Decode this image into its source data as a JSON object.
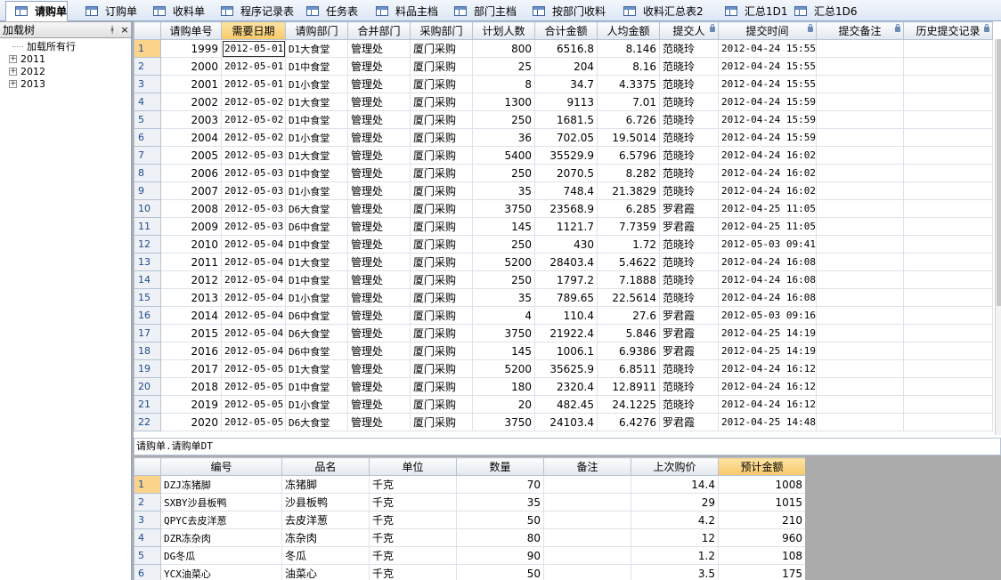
{
  "tabs": [
    {
      "label": "请购单",
      "active": true
    },
    {
      "label": "订购单"
    },
    {
      "label": "收料单"
    },
    {
      "label": "程序记录表"
    },
    {
      "label": "任务表"
    },
    {
      "label": "料品主档"
    },
    {
      "label": "部门主档"
    },
    {
      "label": "按部门收料"
    },
    {
      "label": "收料汇总表2"
    },
    {
      "label": "汇总1D1"
    },
    {
      "label": "汇总1D6"
    }
  ],
  "left_panel": {
    "title": "加载树",
    "pin": "ᚼ",
    "close": "×",
    "tree": [
      {
        "label": "加载所有行",
        "expandable": false
      },
      {
        "label": "2011",
        "expandable": true
      },
      {
        "label": "2012",
        "expandable": true
      },
      {
        "label": "2013",
        "expandable": true
      }
    ]
  },
  "main_grid": {
    "columns": [
      "请购单号",
      "需要日期",
      "请购部门",
      "合并部门",
      "采购部门",
      "计划人数",
      "合计金额",
      "人均金额",
      "提交人",
      "提交时间",
      "提交备注",
      "历史提交记录"
    ],
    "rows": [
      [
        "1",
        "1999",
        "2012-05-01",
        "D1大食堂",
        "管理处",
        "厦门采购",
        "800",
        "6516.8",
        "8.146",
        "范晓玲",
        "2012-04-24 15:55",
        "",
        ""
      ],
      [
        "2",
        "2000",
        "2012-05-01",
        "D1中食堂",
        "管理处",
        "厦门采购",
        "25",
        "204",
        "8.16",
        "范晓玲",
        "2012-04-24 15:55",
        "",
        ""
      ],
      [
        "3",
        "2001",
        "2012-05-01",
        "D1小食堂",
        "管理处",
        "厦门采购",
        "8",
        "34.7",
        "4.3375",
        "范晓玲",
        "2012-04-24 15:55",
        "",
        ""
      ],
      [
        "4",
        "2002",
        "2012-05-02",
        "D1大食堂",
        "管理处",
        "厦门采购",
        "1300",
        "9113",
        "7.01",
        "范晓玲",
        "2012-04-24 15:59",
        "",
        ""
      ],
      [
        "5",
        "2003",
        "2012-05-02",
        "D1中食堂",
        "管理处",
        "厦门采购",
        "250",
        "1681.5",
        "6.726",
        "范晓玲",
        "2012-04-24 15:59",
        "",
        ""
      ],
      [
        "6",
        "2004",
        "2012-05-02",
        "D1小食堂",
        "管理处",
        "厦门采购",
        "36",
        "702.05",
        "19.5014",
        "范晓玲",
        "2012-04-24 15:59",
        "",
        ""
      ],
      [
        "7",
        "2005",
        "2012-05-03",
        "D1大食堂",
        "管理处",
        "厦门采购",
        "5400",
        "35529.9",
        "6.5796",
        "范晓玲",
        "2012-04-24 16:02",
        "",
        ""
      ],
      [
        "8",
        "2006",
        "2012-05-03",
        "D1中食堂",
        "管理处",
        "厦门采购",
        "250",
        "2070.5",
        "8.282",
        "范晓玲",
        "2012-04-24 16:02",
        "",
        ""
      ],
      [
        "9",
        "2007",
        "2012-05-03",
        "D1小食堂",
        "管理处",
        "厦门采购",
        "35",
        "748.4",
        "21.3829",
        "范晓玲",
        "2012-04-24 16:02",
        "",
        ""
      ],
      [
        "10",
        "2008",
        "2012-05-03",
        "D6大食堂",
        "管理处",
        "厦门采购",
        "3750",
        "23568.9",
        "6.285",
        "罗君霞",
        "2012-04-25 11:05",
        "",
        ""
      ],
      [
        "11",
        "2009",
        "2012-05-03",
        "D6中食堂",
        "管理处",
        "厦门采购",
        "145",
        "1121.7",
        "7.7359",
        "罗君霞",
        "2012-04-25 11:05",
        "",
        ""
      ],
      [
        "12",
        "2010",
        "2012-05-04",
        "D1中食堂",
        "管理处",
        "厦门采购",
        "250",
        "430",
        "1.72",
        "范晓玲",
        "2012-05-03 09:41",
        "",
        ""
      ],
      [
        "13",
        "2011",
        "2012-05-04",
        "D1大食堂",
        "管理处",
        "厦门采购",
        "5200",
        "28403.4",
        "5.4622",
        "范晓玲",
        "2012-04-24 16:08",
        "",
        ""
      ],
      [
        "14",
        "2012",
        "2012-05-04",
        "D1中食堂",
        "管理处",
        "厦门采购",
        "250",
        "1797.2",
        "7.1888",
        "范晓玲",
        "2012-04-24 16:08",
        "",
        ""
      ],
      [
        "15",
        "2013",
        "2012-05-04",
        "D1小食堂",
        "管理处",
        "厦门采购",
        "35",
        "789.65",
        "22.5614",
        "范晓玲",
        "2012-04-24 16:08",
        "",
        ""
      ],
      [
        "16",
        "2014",
        "2012-05-04",
        "D6中食堂",
        "管理处",
        "厦门采购",
        "4",
        "110.4",
        "27.6",
        "罗君霞",
        "2012-05-03 09:16",
        "",
        ""
      ],
      [
        "17",
        "2015",
        "2012-05-04",
        "D6大食堂",
        "管理处",
        "厦门采购",
        "3750",
        "21922.4",
        "5.846",
        "罗君霞",
        "2012-04-25 14:19",
        "",
        ""
      ],
      [
        "18",
        "2016",
        "2012-05-04",
        "D6中食堂",
        "管理处",
        "厦门采购",
        "145",
        "1006.1",
        "6.9386",
        "罗君霞",
        "2012-04-25 14:19",
        "",
        ""
      ],
      [
        "19",
        "2017",
        "2012-05-05",
        "D1大食堂",
        "管理处",
        "厦门采购",
        "5200",
        "35625.9",
        "6.8511",
        "范晓玲",
        "2012-04-24 16:12",
        "",
        ""
      ],
      [
        "20",
        "2018",
        "2012-05-05",
        "D1中食堂",
        "管理处",
        "厦门采购",
        "180",
        "2320.4",
        "12.8911",
        "范晓玲",
        "2012-04-24 16:12",
        "",
        ""
      ],
      [
        "21",
        "2019",
        "2012-05-05",
        "D1小食堂",
        "管理处",
        "厦门采购",
        "20",
        "482.45",
        "24.1225",
        "范晓玲",
        "2012-04-24 16:12",
        "",
        ""
      ],
      [
        "22",
        "2020",
        "2012-05-05",
        "D6大食堂",
        "管理处",
        "厦门采购",
        "3750",
        "24103.4",
        "6.4276",
        "罗君霞",
        "2012-04-25 14:48",
        "",
        ""
      ]
    ]
  },
  "detail_caption": "请购单.请购单DT",
  "detail_grid": {
    "columns": [
      "编号",
      "品名",
      "单位",
      "数量",
      "备注",
      "上次购价",
      "预计金额"
    ],
    "rows": [
      [
        "1",
        "DZJ冻猪脚",
        "冻猪脚",
        "千克",
        "70",
        "",
        "14.4",
        "1008"
      ],
      [
        "2",
        "SXBY沙县板鸭",
        "沙县板鸭",
        "千克",
        "35",
        "",
        "29",
        "1015"
      ],
      [
        "3",
        "QPYC去皮洋葱",
        "去皮洋葱",
        "千克",
        "50",
        "",
        "4.2",
        "210"
      ],
      [
        "4",
        "DZR冻杂肉",
        "冻杂肉",
        "千克",
        "80",
        "",
        "12",
        "960"
      ],
      [
        "5",
        "DG冬瓜",
        "冬瓜",
        "千克",
        "90",
        "",
        "1.2",
        "108"
      ],
      [
        "6",
        "YCX油菜心",
        "油菜心",
        "千克",
        "50",
        "",
        "3.5",
        "175"
      ]
    ]
  },
  "colors": {
    "tab_bg": "#dde7f4",
    "highlight_header": "#f7c869",
    "grid_border": "#b7c3d3"
  }
}
